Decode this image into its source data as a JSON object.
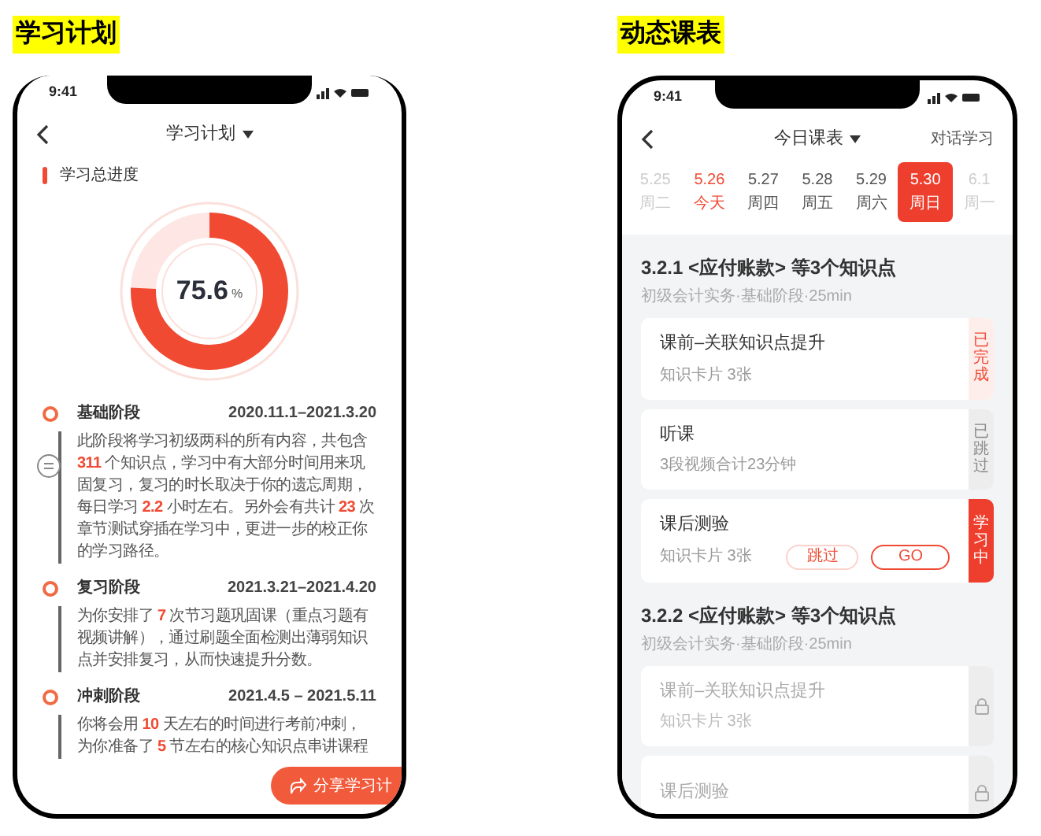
{
  "panels": [
    {
      "title": "学习计划"
    },
    {
      "title": "动态课表"
    }
  ],
  "plan": {
    "time": "9:41",
    "header": "学习计划",
    "section": "学习总进度",
    "progress": {
      "level": 0.756,
      "value": "75.6",
      "unit": "%"
    },
    "stages": [
      {
        "name": "基础阶段",
        "dates": "2020.11.1–2021.3.20",
        "parts": [
          {
            "text": "此阶段将学习初级两科的所有内容，共包含 ",
            "highlight": false
          },
          {
            "text": "311",
            "highlight": true
          },
          {
            "text": " 个知识点，学习中有大部分时间用来巩固复习，复习的时长取决于你的遗忘周期，每日学习 ",
            "highlight": false
          },
          {
            "text": "2.2",
            "highlight": true
          },
          {
            "text": " 小时左右。另外会有共计 ",
            "highlight": false
          },
          {
            "text": "23",
            "highlight": true
          },
          {
            "text": " 次章节测试穿插在学习中，更进一步的校正你的学习路径。",
            "highlight": false
          }
        ]
      },
      {
        "name": "复习阶段",
        "dates": "2021.3.21–2021.4.20",
        "parts": [
          {
            "text": "为你安排了 ",
            "highlight": false
          },
          {
            "text": "7",
            "highlight": true
          },
          {
            "text": " 次节习题巩固课（重点习题有视频讲解），通过刷题全面检测出薄弱知识点并安排复习，从而快速提升分数。",
            "highlight": false
          }
        ]
      },
      {
        "name": "冲刺阶段",
        "dates": "2021.4.5 – 2021.5.11",
        "parts": [
          {
            "text": "你将会用 ",
            "highlight": false
          },
          {
            "text": "10",
            "highlight": true
          },
          {
            "text": " 天左右的时间进行考前冲刺，为你准备了 ",
            "highlight": false
          },
          {
            "text": "5",
            "highlight": true
          },
          {
            "text": " 节左右的核心知识点串讲课程",
            "highlight": false
          }
        ]
      }
    ],
    "share_button": "分享学习计"
  },
  "schedule": {
    "time": "9:41",
    "header": "今日课表",
    "header_action": "对话学习",
    "days": [
      {
        "date": "5.25",
        "weekday": "周二",
        "faded": true,
        "today": false,
        "selected": false
      },
      {
        "date": "5.26",
        "weekday": "今天",
        "faded": false,
        "today": true,
        "selected": false
      },
      {
        "date": "5.27",
        "weekday": "周四",
        "faded": false,
        "today": false,
        "selected": false
      },
      {
        "date": "5.28",
        "weekday": "周五",
        "faded": false,
        "today": false,
        "selected": false
      },
      {
        "date": "5.29",
        "weekday": "周六",
        "faded": false,
        "today": false,
        "selected": false
      },
      {
        "date": "5.30",
        "weekday": "周日",
        "faded": false,
        "today": false,
        "selected": true
      },
      {
        "date": "6.1",
        "weekday": "周一",
        "faded": true,
        "today": false,
        "selected": false
      }
    ],
    "sections": [
      {
        "title": "3.2.1 <应付账款> 等3个知识点",
        "meta": "初级会计实务·基础阶段·25min",
        "lessons": [
          {
            "title": "课前–关联知识点提升",
            "detail": "知识卡片 3张",
            "kind": "done",
            "status": "已完成"
          },
          {
            "title": "听课",
            "detail": "3段视频合计23分钟",
            "kind": "skipped",
            "status": "已跳过"
          },
          {
            "title": "课后测验",
            "detail": "知识卡片 3张",
            "kind": "active",
            "status": "学习中",
            "skip": "跳过",
            "go": "GO"
          }
        ]
      },
      {
        "title": "3.2.2 <应付账款> 等3个知识点",
        "meta": "初级会计实务·基础阶段·25min",
        "lessons": [
          {
            "title": "课前–关联知识点提升",
            "detail": "知识卡片 3张",
            "kind": "locked"
          },
          {
            "title": "课后测验",
            "kind": "locked"
          }
        ]
      }
    ]
  }
}
